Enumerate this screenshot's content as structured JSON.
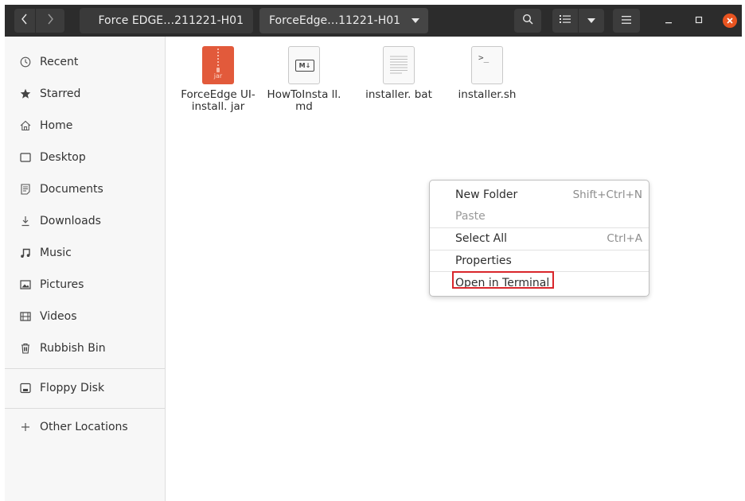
{
  "header": {
    "breadcrumb_left": "Force EDGE…211221-H01",
    "breadcrumb_current": "ForceEdge…11221-H01",
    "icons": {
      "back": "chevron-left-icon",
      "forward": "chevron-right-icon",
      "search": "search-icon",
      "view": "list-view-icon",
      "view_menu": "chevron-down-icon",
      "menu": "hamburger-menu-icon",
      "minimize": "minimize-icon",
      "maximize": "maximize-icon",
      "close": "close-icon"
    },
    "close_color": "#e95420"
  },
  "sidebar": {
    "items": [
      {
        "label": "Recent",
        "icon": "clock-icon"
      },
      {
        "label": "Starred",
        "icon": "star-icon"
      },
      {
        "label": "Home",
        "icon": "home-icon"
      },
      {
        "label": "Desktop",
        "icon": "desktop-icon"
      },
      {
        "label": "Documents",
        "icon": "documents-icon"
      },
      {
        "label": "Downloads",
        "icon": "download-icon"
      },
      {
        "label": "Music",
        "icon": "music-icon"
      },
      {
        "label": "Pictures",
        "icon": "pictures-icon"
      },
      {
        "label": "Videos",
        "icon": "videos-icon"
      },
      {
        "label": "Rubbish Bin",
        "icon": "trash-icon"
      },
      {
        "label": "Floppy Disk",
        "icon": "floppy-disk-icon"
      },
      {
        "label": "Other Locations",
        "icon": "plus-icon"
      }
    ]
  },
  "files": [
    {
      "name": "ForceEdge UI-install. jar",
      "icon": "jar-archive-icon",
      "icon_label": "jar"
    },
    {
      "name": "HowToInsta ll.md",
      "icon": "markdown-file-icon",
      "icon_label": "M↓"
    },
    {
      "name": "installer. bat",
      "icon": "text-file-icon"
    },
    {
      "name": "installer.sh",
      "icon": "shell-script-icon",
      "icon_label": ">_"
    }
  ],
  "context_menu": {
    "items": [
      {
        "label": "New Folder",
        "accel": "Shift+Ctrl+N",
        "enabled": true
      },
      {
        "label": "Paste",
        "accel": "",
        "enabled": false
      },
      {
        "label": "Select All",
        "accel": "Ctrl+A",
        "enabled": true
      },
      {
        "label": "Properties",
        "accel": "",
        "enabled": true
      },
      {
        "label": "Open in Terminal",
        "accel": "",
        "enabled": true,
        "highlighted": true
      }
    ],
    "highlight_color": "#d9262b"
  }
}
